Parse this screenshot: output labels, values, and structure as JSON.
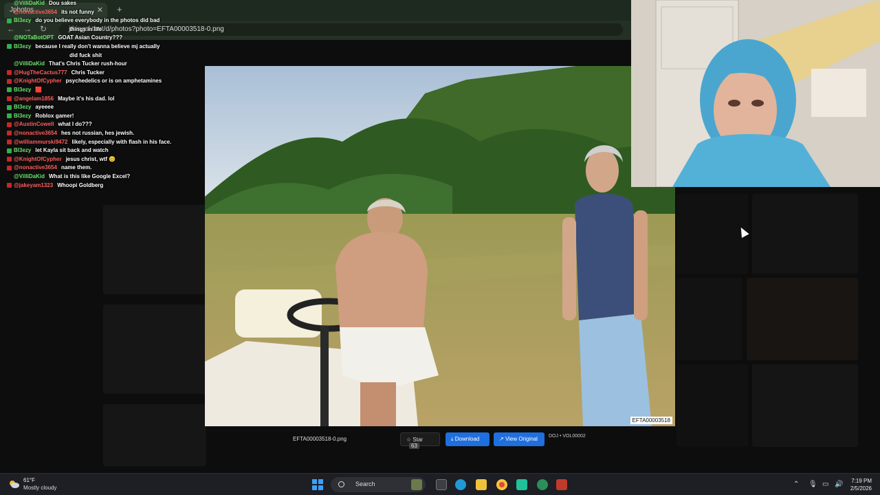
{
  "browser": {
    "tab_title": "Jphotos",
    "new_tab": "+",
    "url": "jthingsl.tbot/d/photos?photo=EFTA00003518-0.png"
  },
  "chat": {
    "messages": [
      {
        "user": "@VilliDaKid",
        "color": "#6be36b",
        "badge": "",
        "text": "Dou sakes"
      },
      {
        "user": "@nonactive3654",
        "color": "#ff5b5b",
        "badge": "",
        "text": "its not funny"
      },
      {
        "user": "Bl3ezy",
        "color": "#6be36b",
        "badge": "#2fb24a",
        "text": "do you believe everybody in the photos did bad"
      },
      {
        "user": "",
        "color": "#ffffff",
        "badge": "",
        "text": "things in life"
      },
      {
        "user": "@NOTaBotOPT",
        "color": "#6be36b",
        "badge": "",
        "text": "GOAT Asian Country???"
      },
      {
        "user": "Bl3ezy",
        "color": "#6be36b",
        "badge": "#2fb24a",
        "text": "because I really don't wanna believe mj actually"
      },
      {
        "user": "",
        "color": "#ffffff",
        "badge": "",
        "text": "did fuck shit"
      },
      {
        "user": "@VilliDaKid",
        "color": "#6be36b",
        "badge": "",
        "text": "That's Chris Tucker rush-hour"
      },
      {
        "user": "@HugTheCactus777",
        "color": "#ff5b5b",
        "badge": "#c62828",
        "text": "Chris Tucker"
      },
      {
        "user": "@KnightOfCypher",
        "color": "#ff5b5b",
        "badge": "#c62828",
        "text": "psychedelics or is on amphetamines"
      },
      {
        "user": "Bl3ezy",
        "color": "#6be36b",
        "badge": "#2fb24a",
        "text": "🟥"
      },
      {
        "user": "@angelam1856",
        "color": "#ff5b5b",
        "badge": "#c62828",
        "text": "Maybe it's his dad. lol"
      },
      {
        "user": "Bl3ezy",
        "color": "#6be36b",
        "badge": "#2fb24a",
        "text": "ayeeee"
      },
      {
        "user": "Bl3ezy",
        "color": "#6be36b",
        "badge": "#2fb24a",
        "text": "Roblox gamer!"
      },
      {
        "user": "@AustinCowell",
        "color": "#ff5b5b",
        "badge": "#c62828",
        "text": "what I do???"
      },
      {
        "user": "@nonactive3654",
        "color": "#ff5b5b",
        "badge": "#c62828",
        "text": "hes not russian, hes jewish."
      },
      {
        "user": "@williammurski9472",
        "color": "#ff5b5b",
        "badge": "#c62828",
        "text": "likely, especially with flash in his face."
      },
      {
        "user": "Bl3ezy",
        "color": "#6be36b",
        "badge": "#2fb24a",
        "text": "let Kayla sit back and watch"
      },
      {
        "user": "@KnightOfCypher",
        "color": "#ff5b5b",
        "badge": "#c62828",
        "text": "jesus christ, wtf 😊"
      },
      {
        "user": "@nonactive3654",
        "color": "#ff5b5b",
        "badge": "#c62828",
        "text": "name them."
      },
      {
        "user": "@VilliDaKid",
        "color": "#6be36b",
        "badge": "",
        "text": "What is this like Google Excel?"
      },
      {
        "user": "@jakeyam1323",
        "color": "#ff5b5b",
        "badge": "#c62828",
        "text": "Whoopi Goldberg"
      }
    ]
  },
  "viewer": {
    "photo_id": "EFTA00003518",
    "filename": "EFTA00003518-0.png",
    "star_label": "Star",
    "star_count": "63",
    "download_label": "Download",
    "view_original_label": "View Original",
    "source": "DOJ • VOL00002"
  },
  "taskbar": {
    "temperature": "61°F",
    "weather": "Mostly cloudy",
    "search_label": "Search",
    "time": "7:19 PM",
    "date": "2/5/2026"
  },
  "icons": {
    "star": "star-icon",
    "download": "download-icon",
    "external": "external-link-icon",
    "windows": "windows-start-icon"
  }
}
